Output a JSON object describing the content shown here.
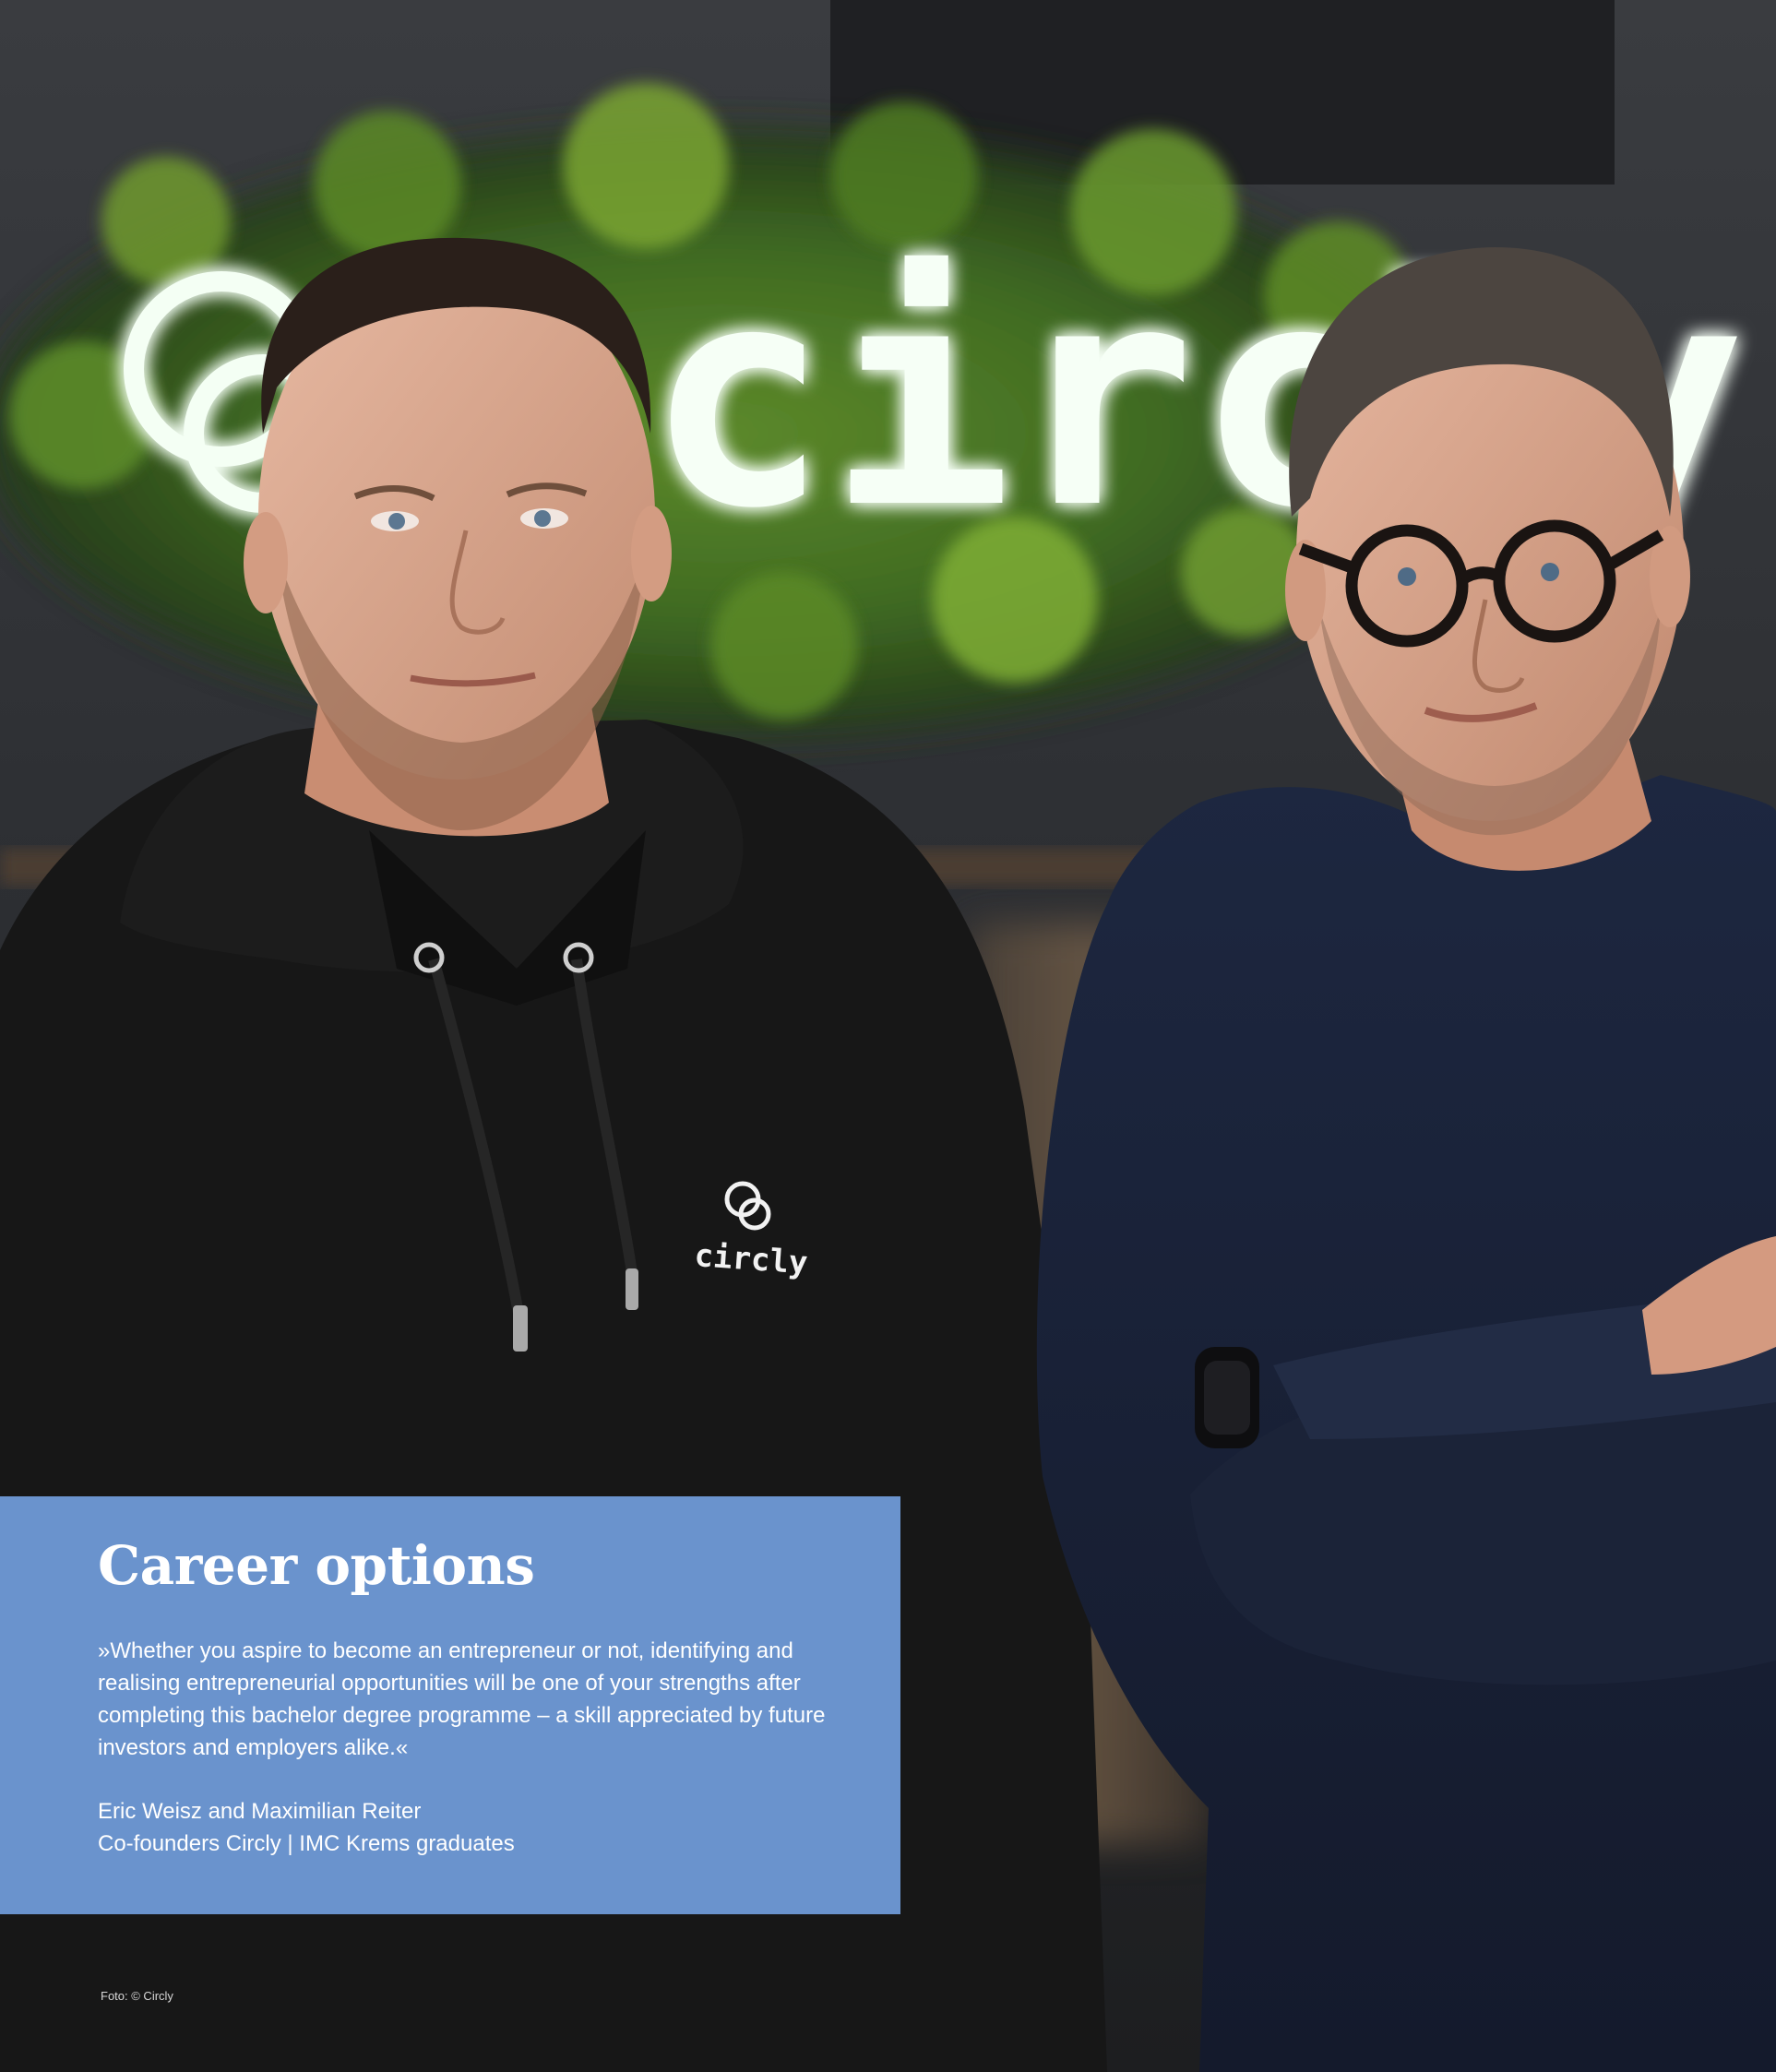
{
  "photo": {
    "sign_text": "circly",
    "hoodie_logo_text": "circly"
  },
  "info_box": {
    "title": "Career options",
    "quote": "»Whether you aspire to become an entrepreneur or not, identifying and realising entrepreneurial opportunities will be one of your strengths after completing this bachelor degree programme – a skill appreciated by future investors and employers alike.«",
    "credit_line_1": "Eric Weisz and Maximilian Reiter",
    "credit_line_2": "Co-founders Circly | IMC Krems graduates",
    "background_color": "#6a93cd"
  },
  "photo_credit": "Foto: © Circly"
}
